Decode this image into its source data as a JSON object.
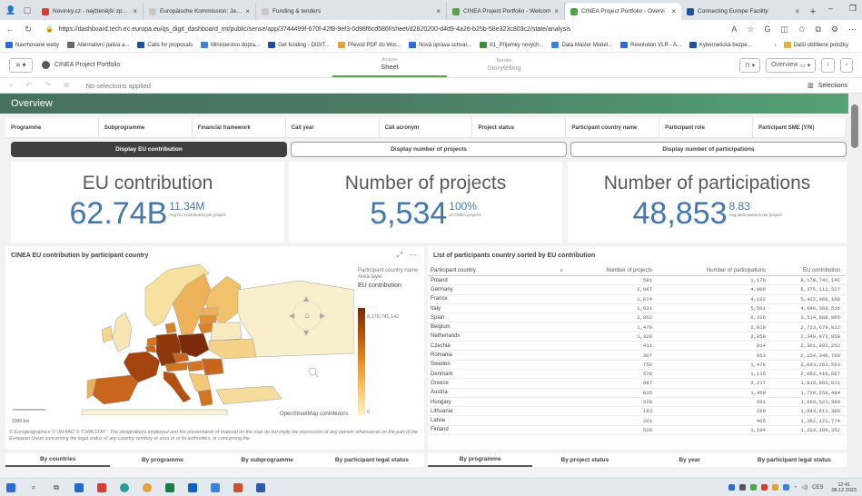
{
  "browser": {
    "tabs": [
      {
        "title": "Novinky.cz - nejčtenější zprávy n",
        "color": "#d23f31"
      },
      {
        "title": "Europäische Kommission: Jahresb",
        "color": "#c9c9c9"
      },
      {
        "title": "Funding & tenders",
        "color": "#c9c9c9"
      },
      {
        "title": "CINEA Project Portfolio - Welcom",
        "color": "#52a34a"
      },
      {
        "title": "CINEA Project Portfolio - Overvi",
        "color": "#52a34a"
      },
      {
        "title": "Connecting Europe Facility",
        "color": "#1f4e9c"
      }
    ],
    "url": "https://dashboard.tech.ec.europa.eu/qs_digit_dashboard_mt/public/sense/app/3744499f-670f-42f8-9ef3-0d98f6cd586f/sheet/d2820200-d4d9-4a26-b25b-58e323c803c2/state/analysis",
    "bookmarks": [
      {
        "label": "Navrhované weby",
        "color": "#2b6bd6"
      },
      {
        "label": "Alternativní paliva a...",
        "color": "#6b6b6b"
      },
      {
        "label": "Calls for proposals",
        "color": "#1f4e9c"
      },
      {
        "label": "Ministerstvo dopra...",
        "color": "#3a85d8"
      },
      {
        "label": "Get funding - DIGIT...",
        "color": "#1f4e9c"
      },
      {
        "label": "Převod PDF do Wor...",
        "color": "#e2a23b"
      },
      {
        "label": "Nová úprava schval...",
        "color": "#2b6bd6"
      },
      {
        "label": "X1_Příjemky nových...",
        "color": "#3c8a3c"
      },
      {
        "label": "Data Master Model...",
        "color": "#3a85d8"
      },
      {
        "label": "Revolution VLR - A...",
        "color": "#2b6bd6"
      },
      {
        "label": "Kybernetická bezpe...",
        "color": "#1f4e9c"
      }
    ],
    "other_bookmarks": "Další oblíbené položky"
  },
  "app": {
    "name": "CINEA Project Portfolio",
    "mode_analyze_label": "Analyze",
    "mode_analyze_value": "Sheet",
    "mode_narrate_label": "Narrate",
    "mode_narrate_value": "Storytelling",
    "overview_btn": "Overview",
    "no_selections": "No selections applied",
    "selections": "Selections"
  },
  "sheet_title": "Overview",
  "filters": [
    "Programme",
    "Subprogramme",
    "Financial framework",
    "Call year",
    "Call acronym",
    "Project status",
    "Participant country name",
    "Participant role",
    "Participant SME (Y/N)"
  ],
  "view_buttons": [
    "Display EU contribution",
    "Display number of projects",
    "Display number of participations"
  ],
  "kpis": [
    {
      "title": "EU contribution",
      "value": "62.74B",
      "sub_value": "11.34M",
      "sub_label": "Avg EU contribution per project"
    },
    {
      "title": "Number of projects",
      "value": "5,534",
      "sub_value": "100%",
      "sub_label": "of CINEA projects"
    },
    {
      "title": "Number of participations",
      "value": "48,853",
      "sub_value": "8.83",
      "sub_label": "Avg participations per project"
    }
  ],
  "map": {
    "title": "CINEA EU contribution by participant country",
    "legend_line1": "Participant country name",
    "legend_line2": "Area layer",
    "legend_measure": "EU contribution",
    "legend_max": "8,178,741,142",
    "legend_min": "0",
    "scale": "1000 km",
    "osm": "OpenStreetMap contributors",
    "attribution": "© Eurogeographics © UN-FAO © TURKSTAT - The designations employed and the presentation of material on the map do not imply the expression of any opinion whatsoever on the part of the European Union concerning the legal status of any country, territory or area or of its authorities, or concerning the"
  },
  "table": {
    "title": "List of participants country sorted by EU contribution",
    "headers": [
      "Participant country",
      "Number of projects",
      "Number of participations",
      "EU contribution"
    ],
    "rows": [
      [
        "Poland",
        "581",
        "1,176",
        "8,178,741,142"
      ],
      [
        "Germany",
        "2,087",
        "4,806",
        "6,375,112,327"
      ],
      [
        "France",
        "1,674",
        "4,102",
        "5,422,968,168"
      ],
      [
        "Italy",
        "1,931",
        "5,501",
        "4,646,368,516"
      ],
      [
        "Spain",
        "2,062",
        "6,336",
        "3,514,888,005"
      ],
      [
        "Belgium",
        "1,479",
        "2,919",
        "2,723,679,822"
      ],
      [
        "Netherlands",
        "1,328",
        "2,858",
        "2,349,873,859"
      ],
      [
        "Czechia",
        "431",
        "814",
        "2,301,893,252"
      ],
      [
        "Romania",
        "307",
        "663",
        "2,154,346,700"
      ],
      [
        "Sweden",
        "756",
        "1,476",
        "2,093,263,593"
      ],
      [
        "Denmark",
        "578",
        "1,115",
        "2,082,418,607"
      ],
      [
        "Greece",
        "987",
        "2,217",
        "1,819,883,811"
      ],
      [
        "Austria",
        "835",
        "1,459",
        "1,729,258,484"
      ],
      [
        "Hungary",
        "328",
        "601",
        "1,669,623,388"
      ],
      [
        "Lithuania",
        "183",
        "298",
        "1,643,812,386"
      ],
      [
        "Latvia",
        "201",
        "405",
        "1,382,121,774"
      ],
      [
        "Finland",
        "529",
        "1,104",
        "1,233,189,352"
      ]
    ]
  },
  "bottom_tabs_left": [
    "By countries",
    "By programme",
    "By subprogramme",
    "By participant legal status"
  ],
  "bottom_tabs_right": [
    "By programme",
    "By project status",
    "By year",
    "By participant legal status"
  ],
  "taskbar": {
    "time": "12:41",
    "date": "08.12.2023",
    "lang": "CES"
  },
  "colors": {
    "accent_green": "#52a34a",
    "kpi_blue": "#4477aa",
    "map_dark": "#7a2a08",
    "map_light": "#fdf0c2"
  }
}
